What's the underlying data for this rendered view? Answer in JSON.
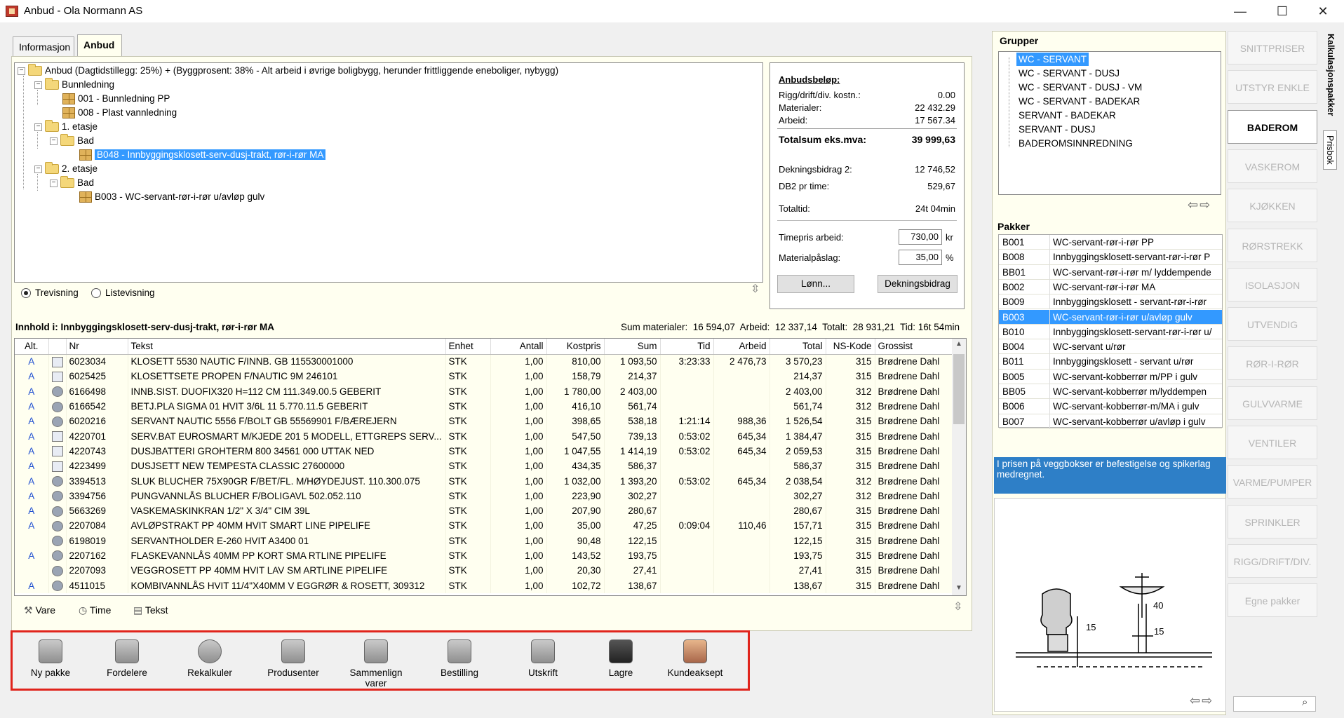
{
  "window": {
    "title": "Anbud - Ola Normann AS",
    "minimize": "—",
    "maximize": "☐",
    "close": "✕"
  },
  "tabs": [
    "Informasjon",
    "Anbud"
  ],
  "tree": {
    "root": "Anbud (Dagtidstillegg: 25%) + (Byggprosent: 38% - Alt arbeid i øvrige boligbygg, herunder frittliggende eneboliger, nybygg)",
    "n1": "Bunnledning",
    "n1a": "001 - Bunnledning PP",
    "n1b": "008 - Plast vannledning",
    "n2": "1. etasje",
    "n2a": "Bad",
    "n2a1": "B048 - Innbyggingsklosett-serv-dusj-trakt, rør-i-rør MA",
    "n3": "2. etasje",
    "n3a": "Bad",
    "n3a1": "B003 - WC-servant-rør-i-rør u/avløp gulv"
  },
  "view": {
    "tree": "Trevisning",
    "list": "Listevisning"
  },
  "summary": {
    "heading": "Anbudsbeløp:",
    "rigg_label": "Rigg/drift/div. kostn.:",
    "rigg": "0.00",
    "mat_label": "Materialer:",
    "mat": "22 432.29",
    "arb_label": "Arbeid:",
    "arb": "17 567.34",
    "total_label": "Totalsum eks.mva:",
    "total": "39 999,63",
    "db2_label": "Dekningsbidrag 2:",
    "db2": "12 746,52",
    "db2t_label": "DB2 pr time:",
    "db2t": "529,67",
    "tid_label": "Totaltid:",
    "tid": "24t 04min",
    "timepris_label": "Timepris arbeid:",
    "timepris": "730,00",
    "timepris_unit": "kr",
    "mp_label": "Materialpåslag:",
    "mp": "35,00",
    "mp_unit": "%",
    "lonn_btn": "Lønn...",
    "db_btn": "Dekningsbidrag"
  },
  "content": {
    "label": "Innhold i: Innbyggingsklosett-serv-dusj-trakt, rør-i-rør MA",
    "totals": "Sum materialer:  16 594,07  Arbeid:  12 337,14  Totalt:  28 931,21  Tid: 16t 54min"
  },
  "table": {
    "headers": [
      "Alt.",
      "",
      "Nr",
      "Tekst",
      "Enhet",
      "Antall",
      "Kostpris",
      "Sum",
      "Tid",
      "Arbeid",
      "Total",
      "NS-Kode",
      "Grossist"
    ],
    "rows": [
      [
        "A",
        "b",
        "6023034",
        "KLOSETT 5530 NAUTIC F/INNB. GB 115530001000",
        "STK",
        "1,00",
        "810,00",
        "1 093,50",
        "3:23:33",
        "2 476,73",
        "3 570,23",
        "315",
        "Brødrene Dahl"
      ],
      [
        "A",
        "b",
        "6025425",
        "KLOSETTSETE PROPEN F/NAUTIC 9M 246101",
        "STK",
        "1,00",
        "158,79",
        "214,37",
        "",
        "",
        "214,37",
        "315",
        "Brødrene Dahl"
      ],
      [
        "A",
        "p",
        "6166498",
        "INNB.SIST. DUOFIX320 H=112 CM 111.349.00.5 GEBERIT",
        "STK",
        "1,00",
        "1 780,00",
        "2 403,00",
        "",
        "",
        "2 403,00",
        "312",
        "Brødrene Dahl"
      ],
      [
        "A",
        "p",
        "6166542",
        "BETJ.PLA SIGMA 01 HVIT 3/6L 11 5.770.11.5 GEBERIT",
        "STK",
        "1,00",
        "416,10",
        "561,74",
        "",
        "",
        "561,74",
        "312",
        "Brødrene Dahl"
      ],
      [
        "A",
        "p",
        "6020216",
        "SERVANT NAUTIC 5556 F/BOLT GB 55569901 F/BÆREJERN",
        "STK",
        "1,00",
        "398,65",
        "538,18",
        "1:21:14",
        "988,36",
        "1 526,54",
        "315",
        "Brødrene Dahl"
      ],
      [
        "A",
        "b",
        "4220701",
        "SERV.BAT EUROSMART M/KJEDE 201 5 MODELL, ETTGREPS SERV...",
        "STK",
        "1,00",
        "547,50",
        "739,13",
        "0:53:02",
        "645,34",
        "1 384,47",
        "315",
        "Brødrene Dahl"
      ],
      [
        "A",
        "b",
        "4220743",
        "DUSJBATTERI GROHTERM 800 34561 000 UTTAK NED",
        "STK",
        "1,00",
        "1 047,55",
        "1 414,19",
        "0:53:02",
        "645,34",
        "2 059,53",
        "315",
        "Brødrene Dahl"
      ],
      [
        "A",
        "b",
        "4223499",
        "DUSJSETT NEW TEMPESTA CLASSIC 27600000",
        "STK",
        "1,00",
        "434,35",
        "586,37",
        "",
        "",
        "586,37",
        "315",
        "Brødrene Dahl"
      ],
      [
        "A",
        "p",
        "3394513",
        "SLUK BLUCHER 75X90GR F/BET/FL. M/HØYDEJUST.     110.300.075",
        "STK",
        "1,00",
        "1 032,00",
        "1 393,20",
        "0:53:02",
        "645,34",
        "2 038,54",
        "312",
        "Brødrene Dahl"
      ],
      [
        "A",
        "p",
        "3394756",
        "PUNGVANNLÅS BLUCHER F/BOLIGAVL 502.052.110",
        "STK",
        "1,00",
        "223,90",
        "302,27",
        "",
        "",
        "302,27",
        "312",
        "Brødrene Dahl"
      ],
      [
        "A",
        "p",
        "5663269",
        "VASKEMASKINKRAN    1/2\" X 3/4\" CIM 39L",
        "STK",
        "1,00",
        "207,90",
        "280,67",
        "",
        "",
        "280,67",
        "315",
        "Brødrene Dahl"
      ],
      [
        "A",
        "p",
        "2207084",
        "AVLØPSTRAKT PP 40MM HVIT SMART LINE PIPELIFE",
        "STK",
        "1,00",
        "35,00",
        "47,25",
        "0:09:04",
        "110,46",
        "157,71",
        "315",
        "Brødrene Dahl"
      ],
      [
        "",
        "p",
        "6198019",
        "SERVANTHOLDER E-260 HVIT A3400 01",
        "STK",
        "1,00",
        "90,48",
        "122,15",
        "",
        "",
        "122,15",
        "315",
        "Brødrene Dahl"
      ],
      [
        "A",
        "p",
        "2207162",
        "FLASKEVANNLÅS 40MM PP KORT SMA RTLINE PIPELIFE",
        "STK",
        "1,00",
        "143,52",
        "193,75",
        "",
        "",
        "193,75",
        "315",
        "Brødrene Dahl"
      ],
      [
        "",
        "p",
        "2207093",
        "VEGGROSETT PP 40MM HVIT LAV SM ARTLINE PIPELIFE",
        "STK",
        "1,00",
        "20,30",
        "27,41",
        "",
        "",
        "27,41",
        "315",
        "Brødrene Dahl"
      ],
      [
        "A",
        "p",
        "4511015",
        "KOMBIVANNLÅS HVIT 11/4\"X40MM V EGGRØR & ROSETT, 309312",
        "STK",
        "1,00",
        "102,72",
        "138,67",
        "",
        "",
        "138,67",
        "315",
        "Brødrene Dahl"
      ]
    ]
  },
  "addbar": {
    "vare": "Vare",
    "time": "Time",
    "tekst": "Tekst"
  },
  "toolbar": [
    "Ny pakke",
    "Fordelere",
    "Rekalkuler",
    "Produsenter",
    "Sammenlign varer",
    "Bestilling",
    "Utskrift",
    "Lagre",
    "Kundeaksept"
  ],
  "groups": {
    "title": "Grupper",
    "items": [
      "WC - SERVANT",
      "WC - SERVANT - DUSJ",
      "WC - SERVANT - DUSJ - VM",
      "WC - SERVANT - BADEKAR",
      "SERVANT - BADEKAR",
      "SERVANT - DUSJ",
      "BADEROMSINNREDNING"
    ]
  },
  "pakker": {
    "title": "Pakker",
    "items": [
      [
        "B001",
        "WC-servant-rør-i-rør PP"
      ],
      [
        "B008",
        "Innbyggingsklosett-servant-rør-i-rør P"
      ],
      [
        "BB01",
        "WC-servant-rør-i-rør m/ lyddempende"
      ],
      [
        "B002",
        "WC-servant-rør-i-rør MA"
      ],
      [
        "B009",
        "Innbyggingsklosett - servant-rør-i-rør"
      ],
      [
        "B003",
        "WC-servant-rør-i-rør u/avløp gulv"
      ],
      [
        "B010",
        "Innbyggingsklosett-servant-rør-i-rør u/"
      ],
      [
        "B004",
        "WC-servant u/rør"
      ],
      [
        "B011",
        "Innbyggingsklosett - servant u/rør"
      ],
      [
        "B005",
        "WC-servant-kobberrør m/PP i gulv"
      ],
      [
        "BB05",
        "WC-servant-kobberrør m/lyddempen"
      ],
      [
        "B006",
        "WC-servant-kobberrør-m/MA i gulv"
      ],
      [
        "B007",
        "WC-servant-kobberrør u/avløp i gulv"
      ]
    ]
  },
  "info": "I prisen på veggbokser er befestigelse og spikerlag medregnet.",
  "diagram": {
    "d1": "15",
    "d2": "40",
    "d3": "15"
  },
  "side": {
    "buttons": [
      "SNITTPRISER",
      "UTSTYR  ENKLE",
      "BADEROM",
      "VASKEROM",
      "KJØKKEN",
      "RØRSTREKK",
      "ISOLASJON",
      "UTVENDIG",
      "RØR-I-RØR",
      "GULVVARME",
      "VENTILER",
      "VARME/PUMPER",
      "SPRINKLER",
      "RIGG/DRIFT/DIV.",
      "Egne pakker"
    ],
    "vtab1": "Kalkulasjonspakker",
    "vtab2": "Prisbok"
  },
  "colors": {
    "selection": "#3399ff",
    "highlight_box": "#e0241c",
    "info_bg": "#2e7fc7"
  }
}
